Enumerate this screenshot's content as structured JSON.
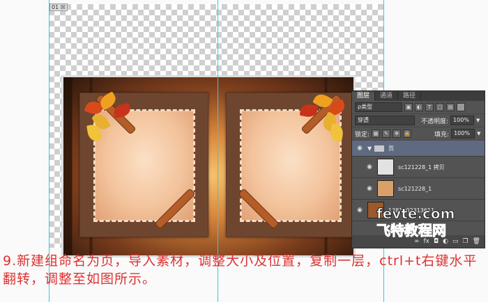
{
  "document": {
    "tab_label": "01 ☒"
  },
  "panel": {
    "tabs": [
      "图层",
      "通道",
      "路径"
    ],
    "filter_kind": "ρ类型",
    "blend_mode": "穿透",
    "opacity_label": "不透明度:",
    "opacity_value": "100%",
    "lock_label": "锁定:",
    "fill_label": "填充:",
    "fill_value": "100%",
    "group_name": "页",
    "layers": [
      {
        "name": "sc121228_1 拷贝"
      },
      {
        "name": "sc121228_1"
      },
      {
        "name": "1381802313611"
      }
    ],
    "footer_icons": [
      "link-icon",
      "fx-icon",
      "mask-icon",
      "adjustment-icon",
      "folder-icon",
      "new-layer-icon",
      "trash-icon"
    ]
  },
  "watermark": {
    "site": "fevte.com",
    "name": "飞特教程网"
  },
  "caption": "9.新建组命名为页，导入素材，调整大小及位置，复制一层，ctrl+t右键水平翻转，调整至如图所示。",
  "colors": {
    "caption": "#e03030",
    "guide": "#39c9d8",
    "panel_bg": "#535353"
  }
}
